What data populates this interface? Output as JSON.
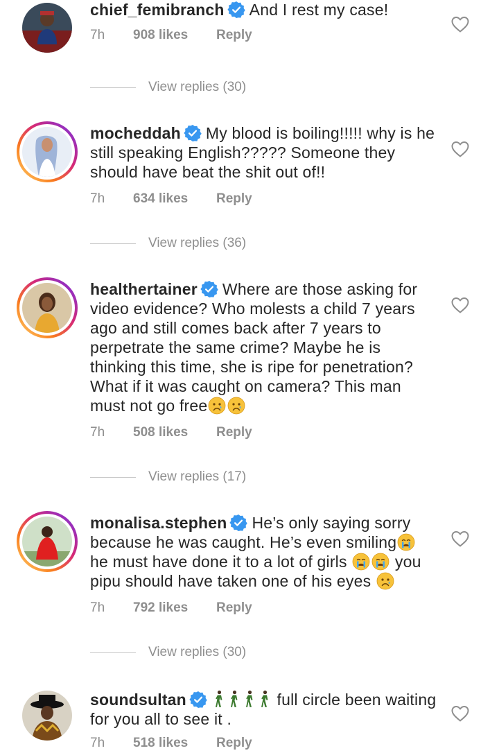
{
  "colors": {
    "verified": "#3897f0",
    "meta": "#8e8e8e",
    "text": "#262626"
  },
  "comments": [
    {
      "username": "chief_femibranch",
      "text": "And I rest my case!",
      "time": "7h",
      "likes": "908 likes",
      "reply": "Reply",
      "view_replies": "View replies (30)"
    },
    {
      "username": "mocheddah",
      "text": "My blood is boiling!!!!! why is he still speaking English????? Someone they should have beat the shit out of!!",
      "time": "7h",
      "likes": "634 likes",
      "reply": "Reply",
      "view_replies": "View replies (36)"
    },
    {
      "username": "healthertainer",
      "text": "Where are those asking for video evidence? Who molests a child 7 years ago and still comes back after 7 years to perpetrate the same crime? Maybe he is thinking this time, she is ripe for penetration? What if it was caught on camera? This man must not go free",
      "time": "7h",
      "likes": "508 likes",
      "reply": "Reply",
      "view_replies": "View replies (17)"
    },
    {
      "username": "monalisa.stephen",
      "text_part1": "He’s only saying sorry because he was caught. He’s even smiling",
      "text_part2": "he must have done it to a lot of girls",
      "text_part3": "you pipu should have taken one of his eyes",
      "time": "7h",
      "likes": "792 likes",
      "reply": "Reply",
      "view_replies": "View replies (30)"
    },
    {
      "username": "soundsultan",
      "text": "full circle been waiting for you all to see it .",
      "time": "7h",
      "likes": "518 likes",
      "reply": "Reply"
    }
  ]
}
